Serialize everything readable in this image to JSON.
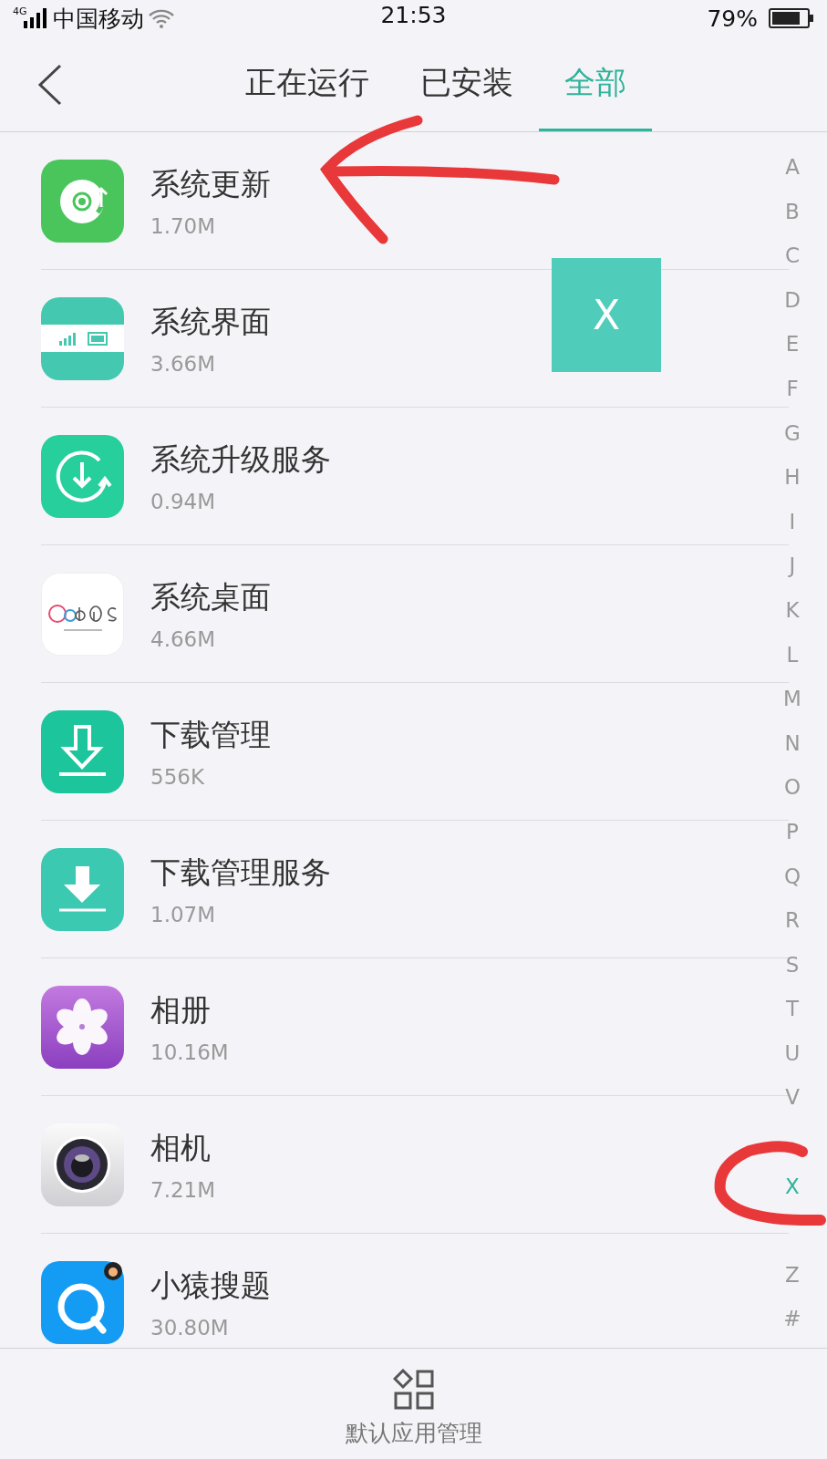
{
  "status_bar": {
    "network": "4G",
    "carrier": "中国移动",
    "time": "21:53",
    "battery": "79%"
  },
  "tabs": [
    {
      "label": "正在运行",
      "selected": false
    },
    {
      "label": "已安装",
      "selected": false
    },
    {
      "label": "全部",
      "selected": true
    }
  ],
  "apps": [
    {
      "name": "系统更新",
      "size": "1.70M"
    },
    {
      "name": "系统界面",
      "size": "3.66M"
    },
    {
      "name": "系统升级服务",
      "size": "0.94M"
    },
    {
      "name": "系统桌面",
      "size": "4.66M"
    },
    {
      "name": "下载管理",
      "size": "556K"
    },
    {
      "name": "下载管理服务",
      "size": "1.07M"
    },
    {
      "name": "相册",
      "size": "10.16M"
    },
    {
      "name": "相机",
      "size": "7.21M"
    },
    {
      "name": "小猿搜题",
      "size": "30.80M"
    }
  ],
  "index_letters": [
    {
      "label": "A",
      "selected": false
    },
    {
      "label": "B",
      "selected": false
    },
    {
      "label": "C",
      "selected": false
    },
    {
      "label": "D",
      "selected": false
    },
    {
      "label": "E",
      "selected": false
    },
    {
      "label": "F",
      "selected": false
    },
    {
      "label": "G",
      "selected": false
    },
    {
      "label": "H",
      "selected": false
    },
    {
      "label": "I",
      "selected": false
    },
    {
      "label": "J",
      "selected": false
    },
    {
      "label": "K",
      "selected": false
    },
    {
      "label": "L",
      "selected": false
    },
    {
      "label": "M",
      "selected": false
    },
    {
      "label": "N",
      "selected": false
    },
    {
      "label": "O",
      "selected": false
    },
    {
      "label": "P",
      "selected": false
    },
    {
      "label": "Q",
      "selected": false
    },
    {
      "label": "R",
      "selected": false
    },
    {
      "label": "S",
      "selected": false
    },
    {
      "label": "T",
      "selected": false
    },
    {
      "label": "U",
      "selected": false
    },
    {
      "label": "V",
      "selected": false
    },
    {
      "label": "X",
      "selected": true
    },
    {
      "label": "Z",
      "selected": false
    },
    {
      "label": "#",
      "selected": false
    }
  ],
  "letter_popup": {
    "letter": "X"
  },
  "bottom_bar": {
    "label": "默认应用管理"
  },
  "annotations": [
    {
      "kind": "arrow"
    },
    {
      "kind": "circle"
    }
  ]
}
